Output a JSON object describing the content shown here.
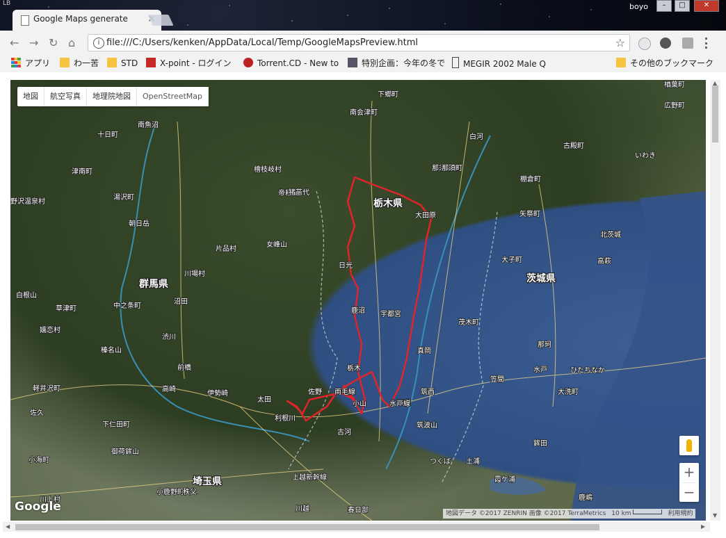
{
  "window": {
    "brand_mark": "LB",
    "user": "boyo",
    "minimize": "–",
    "maximize": "□",
    "close": "✕"
  },
  "tab": {
    "title": "Google Maps generate",
    "close": "×"
  },
  "toolbar": {
    "back": "←",
    "forward": "→",
    "reload": "↻",
    "home": "⌂",
    "info": "i",
    "url": "file:///C:/Users/kenken/AppData/Local/Temp/GoogleMapsPreview.html",
    "star": "☆"
  },
  "bookmarks": {
    "items": [
      {
        "label": "アプリ",
        "icon": "apps-icon"
      },
      {
        "label": "わ一苦",
        "icon": "folder-icon"
      },
      {
        "label": "STD",
        "icon": "folder-icon"
      },
      {
        "label": "X-point - ログイン",
        "icon": "x-icon"
      },
      {
        "label": "Torrent.CD - New to",
        "icon": "site-icon"
      },
      {
        "label": "特別企画：今年の冬で",
        "icon": "site-icon"
      },
      {
        "label": "MEGIR 2002 Male Q",
        "icon": "site-icon"
      }
    ],
    "other": "その他のブックマーク"
  },
  "map": {
    "type_buttons": [
      "地図",
      "航空写真",
      "地理院地図",
      "OpenStreetMap"
    ],
    "selected_type": "OpenStreetMap",
    "zoom_in": "+",
    "zoom_out": "−",
    "google": "Google",
    "attribution": "地図データ ©2017 ZENRIN 画像 ©2017 TerraMetrics",
    "scale": "10 km",
    "terms": "利用規約",
    "labels": [
      {
        "text": "十日町"
      },
      {
        "text": "南魚沼"
      },
      {
        "text": "津南町"
      },
      {
        "text": "湯沢町"
      },
      {
        "text": "野沢温泉村"
      },
      {
        "text": "朝日岳"
      },
      {
        "text": "片品村"
      },
      {
        "text": "檜枝岐村"
      },
      {
        "text": "帝釈山"
      },
      {
        "text": "女峰山"
      },
      {
        "text": "群馬県"
      },
      {
        "text": "沼田"
      },
      {
        "text": "川場村"
      },
      {
        "text": "白根山"
      },
      {
        "text": "草津町"
      },
      {
        "text": "中之条町"
      },
      {
        "text": "嬬恋村"
      },
      {
        "text": "渋川"
      },
      {
        "text": "榛名山"
      },
      {
        "text": "前橋"
      },
      {
        "text": "高崎"
      },
      {
        "text": "伊勢崎"
      },
      {
        "text": "太田"
      },
      {
        "text": "軽井沢町"
      },
      {
        "text": "佐久"
      },
      {
        "text": "下仁田町"
      },
      {
        "text": "御荷鉾山"
      },
      {
        "text": "小海町"
      },
      {
        "text": "埼玉県"
      },
      {
        "text": "小鹿野町"
      },
      {
        "text": "秩父"
      },
      {
        "text": "川上村"
      },
      {
        "text": "下郷町"
      },
      {
        "text": "南会津町"
      },
      {
        "text": "白河"
      },
      {
        "text": "那須塩原"
      },
      {
        "text": "栃木県"
      },
      {
        "text": "大田原"
      },
      {
        "text": "日光"
      },
      {
        "text": "鹿沼"
      },
      {
        "text": "宇都宮"
      },
      {
        "text": "栃木"
      },
      {
        "text": "佐野"
      },
      {
        "text": "小山"
      },
      {
        "text": "古河"
      },
      {
        "text": "真岡"
      },
      {
        "text": "筑西"
      },
      {
        "text": "下妻"
      },
      {
        "text": "筑波山"
      },
      {
        "text": "茨城県"
      },
      {
        "text": "茂木町"
      },
      {
        "text": "大子町"
      },
      {
        "text": "那珂"
      },
      {
        "text": "水戸"
      },
      {
        "text": "ひたちなか"
      },
      {
        "text": "笠間"
      },
      {
        "text": "大洗町"
      },
      {
        "text": "つくば"
      },
      {
        "text": "土浦"
      },
      {
        "text": "鉾田"
      },
      {
        "text": "鹿嶋"
      },
      {
        "text": "霞ケ浦"
      },
      {
        "text": "春日部"
      },
      {
        "text": "川越"
      },
      {
        "text": "いわき"
      },
      {
        "text": "北茨城"
      },
      {
        "text": "高萩"
      },
      {
        "text": "広野町"
      },
      {
        "text": "楢葉町"
      },
      {
        "text": "古殿町"
      },
      {
        "text": "矢祭町"
      },
      {
        "text": "棚倉町"
      },
      {
        "text": "那須町"
      },
      {
        "text": "猪苗代"
      },
      {
        "text": "両毛線"
      },
      {
        "text": "水戸線"
      },
      {
        "text": "上越新幹線"
      },
      {
        "text": "利根川"
      }
    ]
  },
  "colors": {
    "route": "#e0242a",
    "road": "#f3d98a",
    "boundary": "#d9d9d9"
  }
}
